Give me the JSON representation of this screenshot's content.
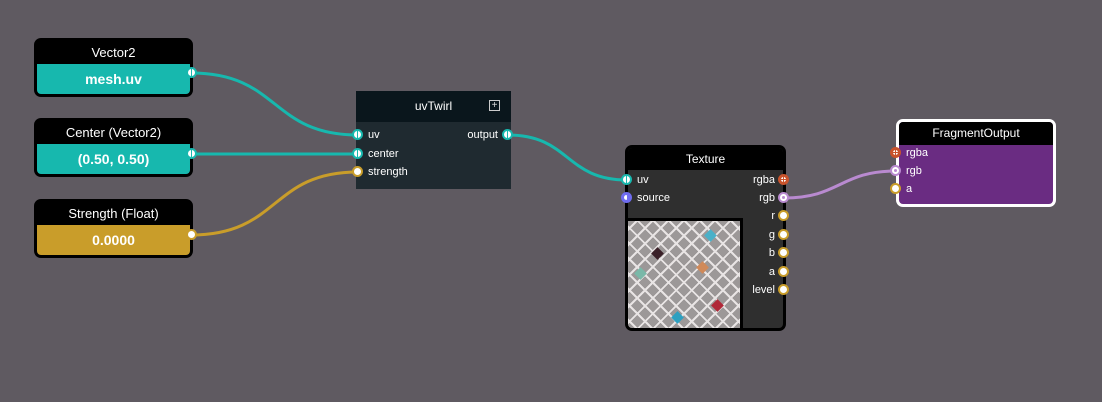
{
  "nodes": {
    "vector2": {
      "title": "Vector2",
      "value": "mesh.uv"
    },
    "center": {
      "title": "Center (Vector2)",
      "value": "(0.50, 0.50)"
    },
    "strength": {
      "title": "Strength (Float)",
      "value": "0.0000"
    },
    "uvtwirl": {
      "title": "uvTwirl",
      "inputs": [
        "uv",
        "center",
        "strength"
      ],
      "output": "output"
    },
    "texture": {
      "title": "Texture",
      "inputs": [
        "uv",
        "source"
      ],
      "outputs": [
        "rgba",
        "rgb",
        "r",
        "g",
        "b",
        "a",
        "level"
      ]
    },
    "fragment_output": {
      "title": "FragmentOutput",
      "inputs": [
        "rgba",
        "rgb",
        "a"
      ]
    }
  },
  "colors": {
    "vec2": "#17b8ae",
    "float": "#c99d2a",
    "vec3": "#b98ad0",
    "vec4": "#c8532c",
    "texture": "#6f6cf0",
    "output_body": "#6a2c82"
  }
}
